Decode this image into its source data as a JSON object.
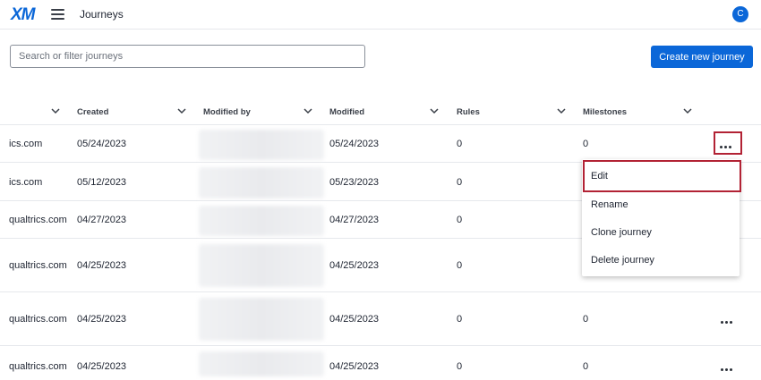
{
  "header": {
    "logo": "XM",
    "title": "Journeys",
    "avatar_initial": "C",
    "menu_icon": "hamburger-menu-icon"
  },
  "toolbar": {
    "search_placeholder": "Search or filter journeys",
    "search_value": "",
    "create_label": "Create new journey"
  },
  "table": {
    "columns": [
      "",
      "Created",
      "Modified by",
      "Modified",
      "Rules",
      "Milestones"
    ],
    "rows": [
      {
        "owner": "ics.com",
        "created": "05/24/2023",
        "modified_by": "",
        "modified": "05/24/2023",
        "rules": "0",
        "milestones": "0"
      },
      {
        "owner": "ics.com",
        "created": "05/12/2023",
        "modified_by": "",
        "modified": "05/23/2023",
        "rules": "0",
        "milestones": ""
      },
      {
        "owner": "qualtrics.com",
        "created": "04/27/2023",
        "modified_by": "",
        "modified": "04/27/2023",
        "rules": "0",
        "milestones": ""
      },
      {
        "owner": "qualtrics.com",
        "created": "04/25/2023",
        "modified_by": "",
        "modified": "04/25/2023",
        "rules": "0",
        "milestones": ""
      },
      {
        "owner": "qualtrics.com",
        "created": "04/25/2023",
        "modified_by": "",
        "modified": "04/25/2023",
        "rules": "0",
        "milestones": "0"
      },
      {
        "owner": "qualtrics.com",
        "created": "04/25/2023",
        "modified_by": "",
        "modified": "04/25/2023",
        "rules": "0",
        "milestones": "0"
      }
    ]
  },
  "row_menu": {
    "items": [
      "Edit",
      "Rename",
      "Clone journey",
      "Delete journey"
    ]
  },
  "colors": {
    "accent": "#0b67d8",
    "highlight": "#b22234"
  }
}
